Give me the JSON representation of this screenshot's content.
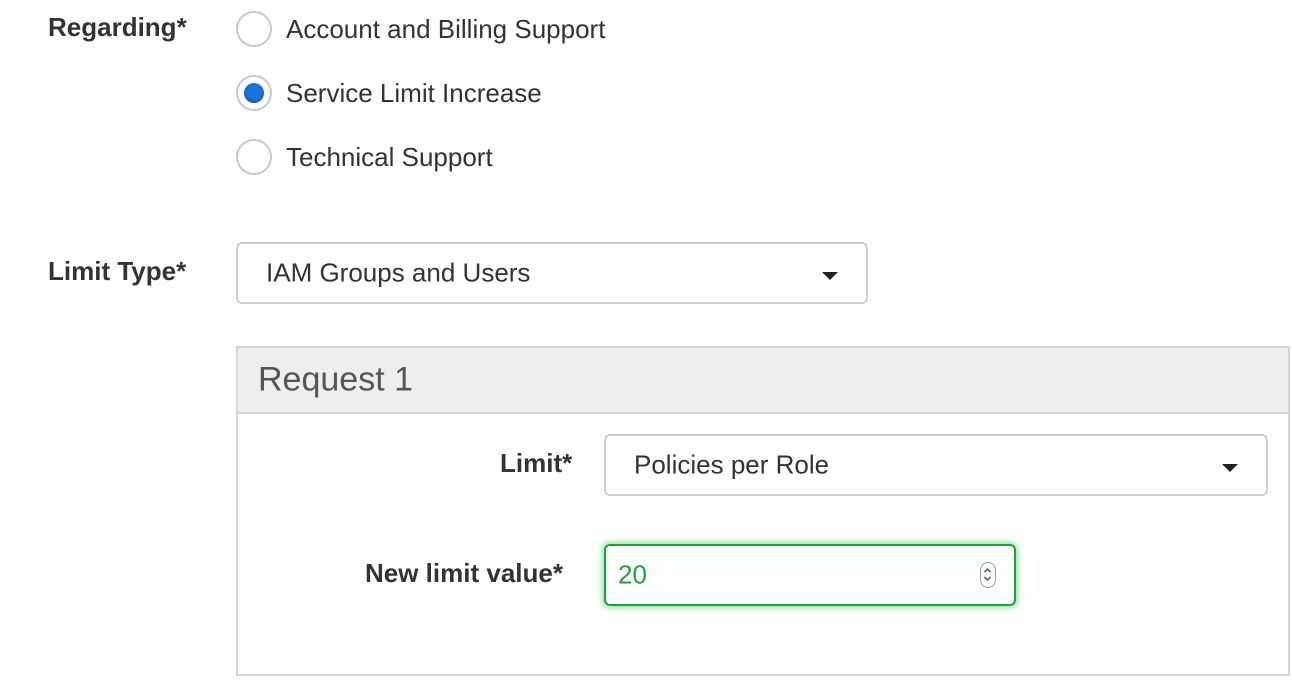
{
  "regarding": {
    "label": "Regarding*",
    "options": [
      {
        "label": "Account and Billing Support",
        "checked": false
      },
      {
        "label": "Service Limit Increase",
        "checked": true
      },
      {
        "label": "Technical Support",
        "checked": false
      }
    ]
  },
  "limit_type": {
    "label": "Limit Type*",
    "selected": "IAM Groups and Users"
  },
  "request": {
    "title": "Request 1",
    "limit": {
      "label": "Limit*",
      "selected": "Policies per Role"
    },
    "new_limit_value": {
      "label": "New limit value*",
      "value": "20"
    }
  },
  "colors": {
    "radio_checked": "#1a73d6",
    "valid_input": "#22a03a",
    "panel_header_bg": "#eeeeee"
  },
  "icons": {
    "dropdown": "caret-down-icon",
    "spinner": "number-spinner-icon"
  }
}
